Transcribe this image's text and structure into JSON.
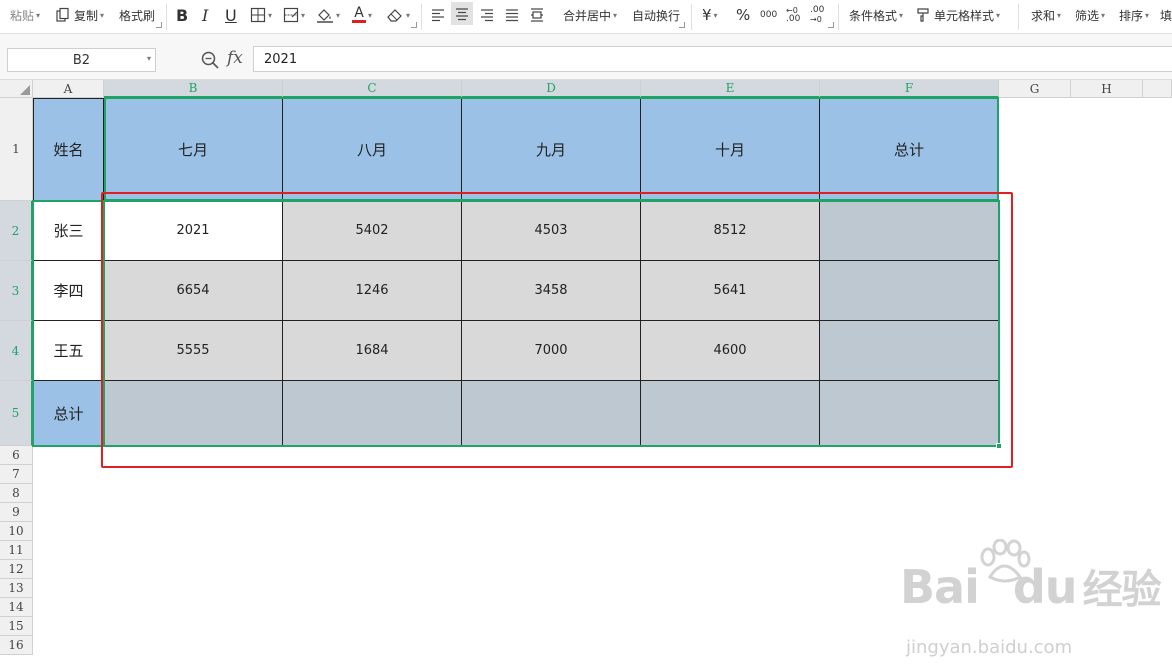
{
  "ribbon": {
    "paste": "粘贴",
    "copy": "复制",
    "format_painter": "格式刷",
    "bold": "B",
    "italic": "I",
    "underline": "U",
    "font_color_letter": "A",
    "merge_center": "合并居中",
    "wrap_text": "自动换行",
    "currency": "¥",
    "percent": "%",
    "thousands": "000",
    "dec_add": ".00",
    "dec_remove": ".00",
    "conditional_format": "条件格式",
    "cell_style": "单元格样式",
    "sum": "求和",
    "filter": "筛选",
    "sort": "排序",
    "fill": "填"
  },
  "formula_bar": {
    "name_box": "B2",
    "fx": "fx",
    "value": "2021"
  },
  "columns": [
    "A",
    "B",
    "C",
    "D",
    "E",
    "F",
    "G",
    "H"
  ],
  "rows": [
    "1",
    "2",
    "3",
    "4",
    "5",
    "6",
    "7",
    "8",
    "9",
    "10",
    "11",
    "12",
    "13",
    "14",
    "15",
    "16"
  ],
  "table": {
    "header": [
      "姓名",
      "七月",
      "八月",
      "九月",
      "十月",
      "总计"
    ],
    "body": [
      {
        "name": "张三",
        "values": [
          "2021",
          "5402",
          "4503",
          "8512",
          ""
        ]
      },
      {
        "name": "李四",
        "values": [
          "6654",
          "1246",
          "3458",
          "5641",
          ""
        ]
      },
      {
        "name": "王五",
        "values": [
          "5555",
          "1684",
          "7000",
          "4600",
          ""
        ]
      }
    ],
    "total_row": {
      "name": "总计",
      "values": [
        "",
        "",
        "",
        "",
        ""
      ]
    }
  },
  "colors": {
    "header_fill": "#9bc2e6",
    "data_fill": "#d9d9d9",
    "total_fill": "#bdc8d1",
    "selection": "#21a366",
    "highlight_box": "#e02020"
  },
  "watermark": {
    "main": "Bai",
    "main2": "du",
    "main3": "经验",
    "sub": "jingyan.baidu.com"
  }
}
